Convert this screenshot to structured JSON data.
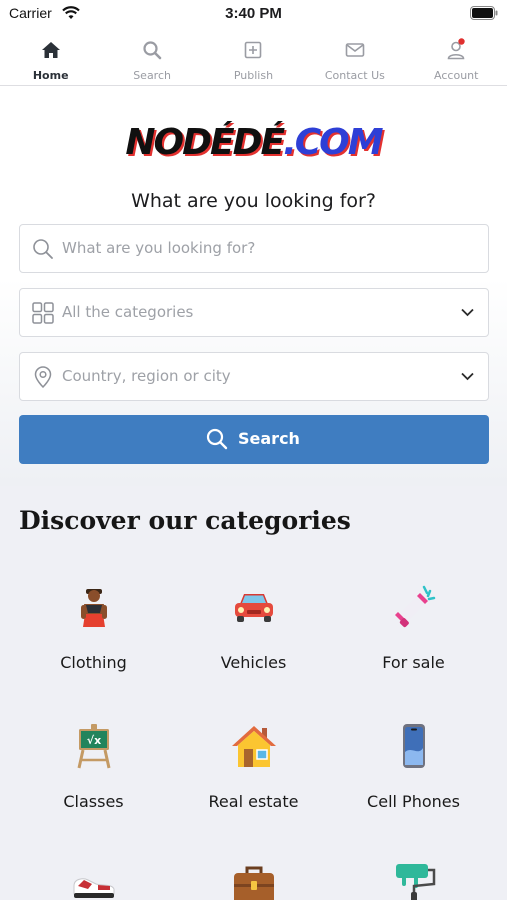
{
  "status": {
    "carrier": "Carrier",
    "time": "3:40 PM"
  },
  "tabs": [
    {
      "label": "Home",
      "icon": "home-icon",
      "active": true
    },
    {
      "label": "Search",
      "icon": "search-icon",
      "active": false
    },
    {
      "label": "Publish",
      "icon": "plus-square-icon",
      "active": false
    },
    {
      "label": "Contact Us",
      "icon": "mail-icon",
      "active": false
    },
    {
      "label": "Account",
      "icon": "user-icon",
      "active": false,
      "notification": true
    }
  ],
  "brand": {
    "logo_part1": "NODÉDÉ",
    "logo_part2": ".COM"
  },
  "hero": {
    "title": "What are you looking for?",
    "keyword_placeholder": "What are you looking for?",
    "category_placeholder": "All the categories",
    "location_placeholder": "Country, region or city",
    "search_label": "Search"
  },
  "discover": {
    "title": "Discover our categories",
    "categories": [
      {
        "label": "Clothing",
        "icon": "clothing-icon"
      },
      {
        "label": "Vehicles",
        "icon": "car-icon"
      },
      {
        "label": "For sale",
        "icon": "megaphone-icon"
      },
      {
        "label": "Classes",
        "icon": "chalkboard-icon"
      },
      {
        "label": "Real estate",
        "icon": "house-icon"
      },
      {
        "label": "Cell Phones",
        "icon": "phone-icon"
      }
    ]
  },
  "colors": {
    "accent": "#3f7dc1",
    "background": "#eff0f5",
    "notification": "#e0302f"
  }
}
